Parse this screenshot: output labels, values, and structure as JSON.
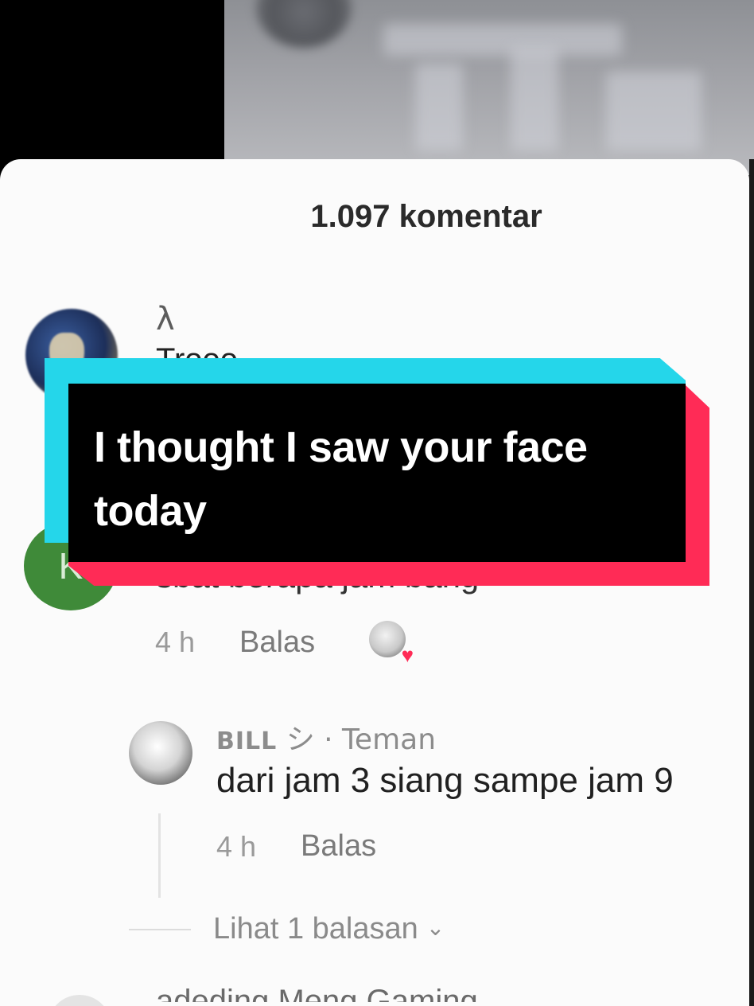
{
  "comments_sheet": {
    "count_label": "1.097 komentar"
  },
  "first_comment": {
    "username": "λ",
    "partial_text": "Trooo"
  },
  "overlay_caption": {
    "line1": "I thought I saw your face",
    "line2": "today",
    "colors": {
      "cyan": "#25d6ea",
      "red": "#ff2b56",
      "black": "#000000",
      "text": "#ffffff"
    }
  },
  "second_comment": {
    "avatar_letter": "K",
    "partial_text": "sbat berapa jam bang",
    "time": "4 h",
    "reply_label": "Balas",
    "creator_liked_icon": "creator-liked-heart-icon"
  },
  "reply_comment": {
    "username": "BILL",
    "username_suffix": "シ · Teman",
    "text": "dari jam 3 siang sampe jam 9",
    "time": "4 h",
    "reply_label": "Balas"
  },
  "view_replies": {
    "label": "Lihat 1 balasan",
    "icon": "chevron-down-icon"
  },
  "next_comment": {
    "partial_username": "adeding Meng Gaming"
  }
}
